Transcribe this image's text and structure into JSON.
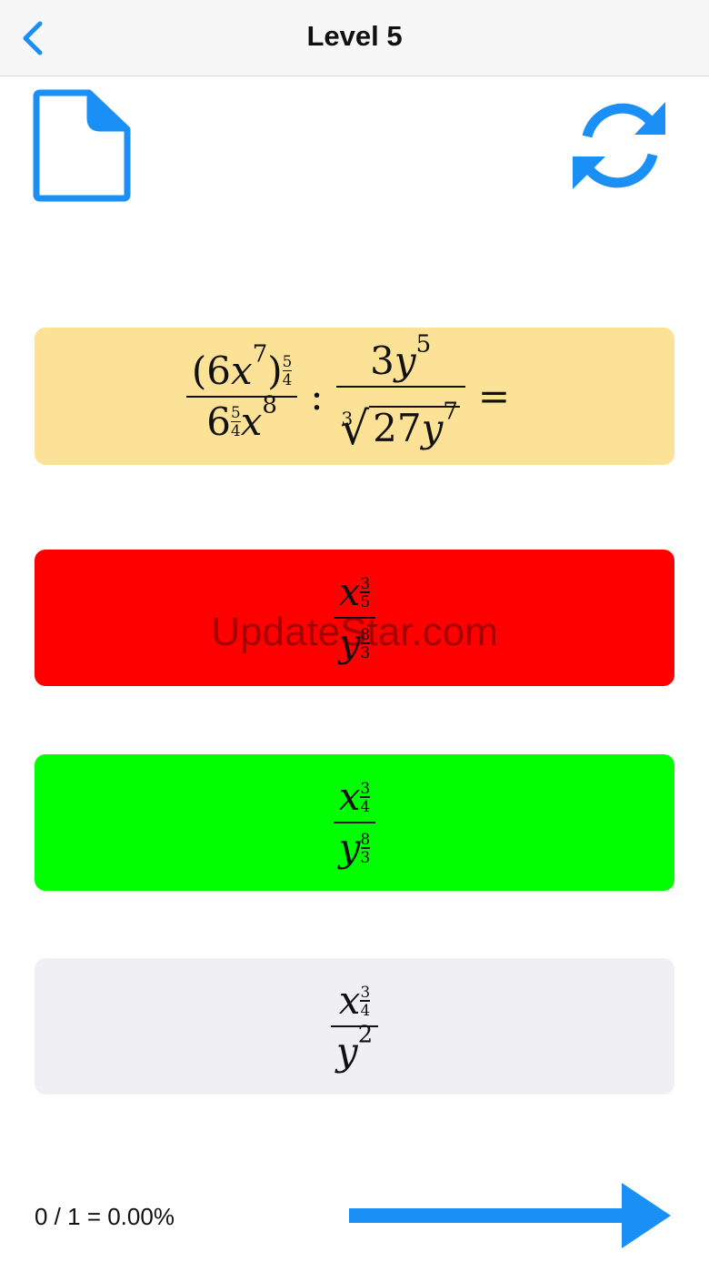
{
  "nav": {
    "title": "Level 5"
  },
  "question": {
    "left_num_base": "(6",
    "left_num_var": "x",
    "left_num_exp": "7",
    "left_num_close": ")",
    "left_num_outer_exp_num": "5",
    "left_num_outer_exp_den": "4",
    "left_den_base": "6",
    "left_den_exp_num": "5",
    "left_den_exp_den": "4",
    "left_den_var": "x",
    "left_den_var_exp": "8",
    "divide": ":",
    "right_num_coef": "3",
    "right_num_var": "y",
    "right_num_exp": "5",
    "right_den_index": "3",
    "right_den_coef": "27",
    "right_den_var": "y",
    "right_den_exp": "7",
    "equals": "="
  },
  "options": [
    {
      "num_var": "x",
      "num_exp_num": "3",
      "num_exp_den": "5",
      "den_var": "y",
      "den_exp_num": "8",
      "den_exp_den": "3"
    },
    {
      "num_var": "x",
      "num_exp_num": "3",
      "num_exp_den": "4",
      "den_var": "y",
      "den_exp_num": "8",
      "den_exp_den": "3"
    },
    {
      "num_var": "x",
      "num_exp_num": "3",
      "num_exp_den": "4",
      "den_var": "y",
      "den_exp": "2"
    }
  ],
  "watermark": "UpdateStar.com",
  "score": "0 / 1 = 0.00%",
  "colors": {
    "accent": "#1a8ff5",
    "question_bg": "#fce297",
    "wrong": "#ff0000",
    "correct": "#00ff00",
    "neutral": "#efeff4"
  },
  "icons": {
    "back": "chevron-left-icon",
    "document": "document-icon",
    "refresh": "refresh-icon",
    "next": "arrow-right-icon"
  }
}
